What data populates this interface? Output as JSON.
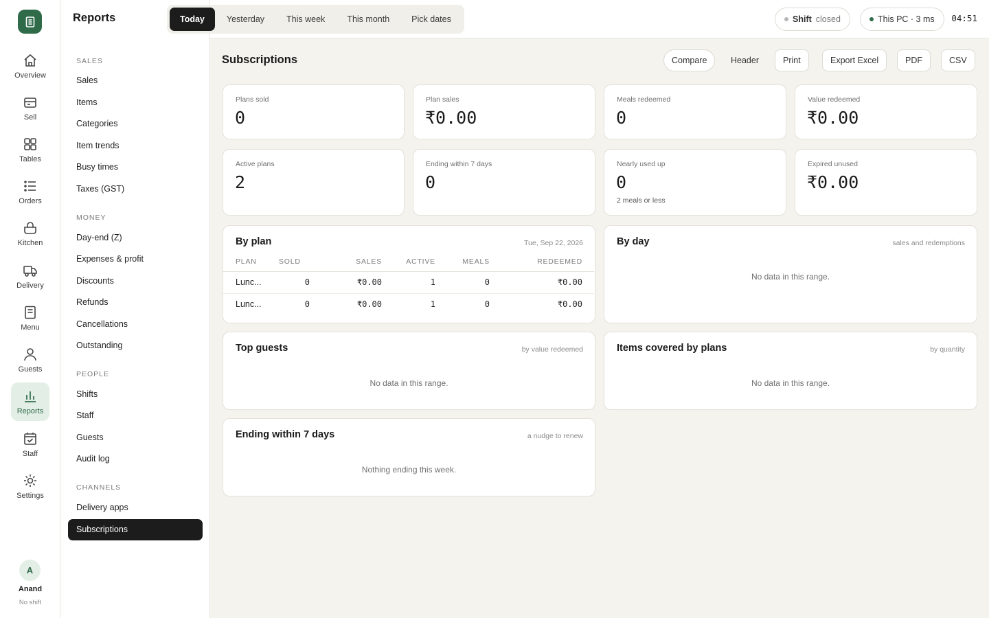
{
  "rail": {
    "items": [
      {
        "label": "Overview",
        "icon": "home-icon"
      },
      {
        "label": "Sell",
        "icon": "register-icon"
      },
      {
        "label": "Tables",
        "icon": "grid-icon"
      },
      {
        "label": "Orders",
        "icon": "list-icon"
      },
      {
        "label": "Kitchen",
        "icon": "pot-icon"
      },
      {
        "label": "Delivery",
        "icon": "truck-icon"
      },
      {
        "label": "Menu",
        "icon": "menu-doc-icon"
      },
      {
        "label": "Guests",
        "icon": "person-icon"
      },
      {
        "label": "Reports",
        "icon": "bar-chart-icon",
        "active": true
      },
      {
        "label": "Staff",
        "icon": "calendar-check-icon"
      },
      {
        "label": "Settings",
        "icon": "sun-gear-icon"
      }
    ],
    "user": {
      "initial": "A",
      "name": "Anand",
      "status": "No shift"
    }
  },
  "sidebar": {
    "title": "Reports",
    "sections": [
      {
        "heading": "SALES",
        "links": [
          "Sales",
          "Items",
          "Categories",
          "Item trends",
          "Busy times",
          "Taxes (GST)"
        ]
      },
      {
        "heading": "MONEY",
        "links": [
          "Day-end (Z)",
          "Expenses & profit",
          "Discounts",
          "Refunds",
          "Cancellations",
          "Outstanding"
        ]
      },
      {
        "heading": "PEOPLE",
        "links": [
          "Shifts",
          "Staff",
          "Guests",
          "Audit log"
        ]
      },
      {
        "heading": "CHANNELS",
        "links": [
          "Delivery apps",
          "Subscriptions"
        ]
      }
    ],
    "active": "Subscriptions"
  },
  "topbar": {
    "ranges": [
      "Today",
      "Yesterday",
      "This week",
      "This month",
      "Pick dates"
    ],
    "active_range": "Today",
    "shift_label": "Shift",
    "shift_state": "closed",
    "device": "This PC · 3 ms",
    "clock": "04:51",
    "colors": {
      "shift_dot": "#b5b5b5",
      "device_dot": "#2f6a49"
    }
  },
  "page": {
    "title": "Subscriptions",
    "actions": {
      "compare": "Compare",
      "header": "Header",
      "print": "Print",
      "excel": "Export Excel",
      "pdf": "PDF",
      "csv": "CSV"
    }
  },
  "stats": [
    {
      "label": "Plans sold",
      "value": "0"
    },
    {
      "label": "Plan sales",
      "value": "₹0.00"
    },
    {
      "label": "Meals redeemed",
      "value": "0"
    },
    {
      "label": "Value redeemed",
      "value": "₹0.00"
    },
    {
      "label": "Active plans",
      "value": "2"
    },
    {
      "label": "Ending within 7 days",
      "value": "0"
    },
    {
      "label": "Nearly used up",
      "value": "0",
      "foot": "2 meals or less"
    },
    {
      "label": "Expired unused",
      "value": "₹0.00"
    }
  ],
  "by_plan": {
    "title": "By plan",
    "date": "Tue, Sep 22, 2026",
    "columns": [
      "PLAN",
      "SOLD",
      "SALES",
      "ACTIVE",
      "MEALS",
      "REDEEMED"
    ],
    "rows": [
      [
        "Lunc...",
        "0",
        "₹0.00",
        "1",
        "0",
        "₹0.00"
      ],
      [
        "Lunc...",
        "0",
        "₹0.00",
        "1",
        "0",
        "₹0.00"
      ]
    ]
  },
  "by_day": {
    "title": "By day",
    "sub": "sales and redemptions",
    "empty": "No data in this range."
  },
  "top_guests": {
    "title": "Top guests",
    "sub": "by value redeemed",
    "empty": "No data in this range."
  },
  "items_covered": {
    "title": "Items covered by plans",
    "sub": "by quantity",
    "empty": "No data in this range."
  },
  "ending": {
    "title": "Ending within 7 days",
    "sub": "a nudge to renew",
    "empty": "Nothing ending this week."
  },
  "colors": {
    "brand": "#2f6a49",
    "active_dark": "#1c1c1c",
    "background": "#f4f3ee"
  }
}
